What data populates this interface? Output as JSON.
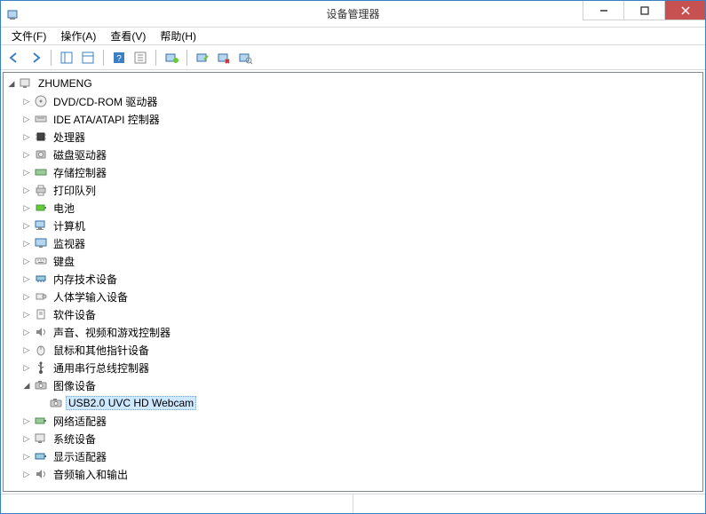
{
  "title": "设备管理器",
  "menu": {
    "file": "文件(F)",
    "action": "操作(A)",
    "view": "查看(V)",
    "help": "帮助(H)"
  },
  "root": "ZHUMENG",
  "nodes": {
    "dvd": "DVD/CD-ROM 驱动器",
    "ide": "IDE ATA/ATAPI 控制器",
    "cpu": "处理器",
    "disk": "磁盘驱动器",
    "storage": "存储控制器",
    "print": "打印队列",
    "battery": "电池",
    "computer": "计算机",
    "monitor": "监视器",
    "keyboard": "键盘",
    "memory": "内存技术设备",
    "hid": "人体学输入设备",
    "software": "软件设备",
    "audio": "声音、视频和游戏控制器",
    "mouse": "鼠标和其他指针设备",
    "usb": "通用串行总线控制器",
    "imaging": "图像设备",
    "webcam": "USB2.0 UVC HD Webcam",
    "network": "网络适配器",
    "system": "系统设备",
    "display": "显示适配器",
    "audioio": "音频输入和输出"
  }
}
